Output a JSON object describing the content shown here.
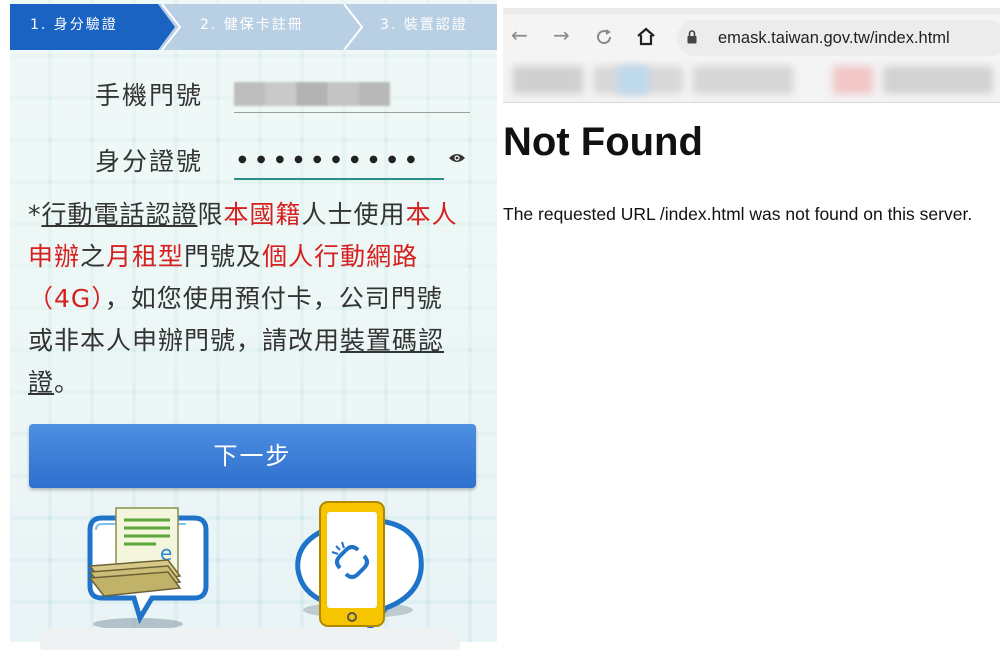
{
  "steps": [
    "1. 身分驗證",
    "2. 健保卡註冊",
    "3. 裝置認證"
  ],
  "form": {
    "phone_label": "手機門號",
    "id_label": "身分證號",
    "id_value": "●●●●●●●●●●"
  },
  "note": {
    "p1": "*",
    "p2": "行動電話認證",
    "p3": "限",
    "p4": "本國籍",
    "p5": "人士使用",
    "p6": "本人申辦",
    "p7": "之",
    "p8": "月租型",
    "p9": "門號及",
    "p10": "個人行動網路（4G）",
    "p11": "，如您使用預付卡，公司門號或非本人申辦門號，請改用",
    "p12": "裝置碼認證",
    "p13": "。"
  },
  "next_button": "下一步",
  "browser": {
    "url": "emask.taiwan.gov.tw/index.html",
    "heading": "Not Found",
    "message": "The requested URL /index.html was not found on this server."
  },
  "icons": {
    "back": "←",
    "forward": "→",
    "reload": "C",
    "home": "⌂"
  },
  "colors": {
    "step_active": "#1a63c2",
    "step_inactive": "#b9cfe4",
    "highlight_red": "#d62020",
    "button_blue": "#3b7bd6",
    "field_accent": "#2a8f86"
  }
}
